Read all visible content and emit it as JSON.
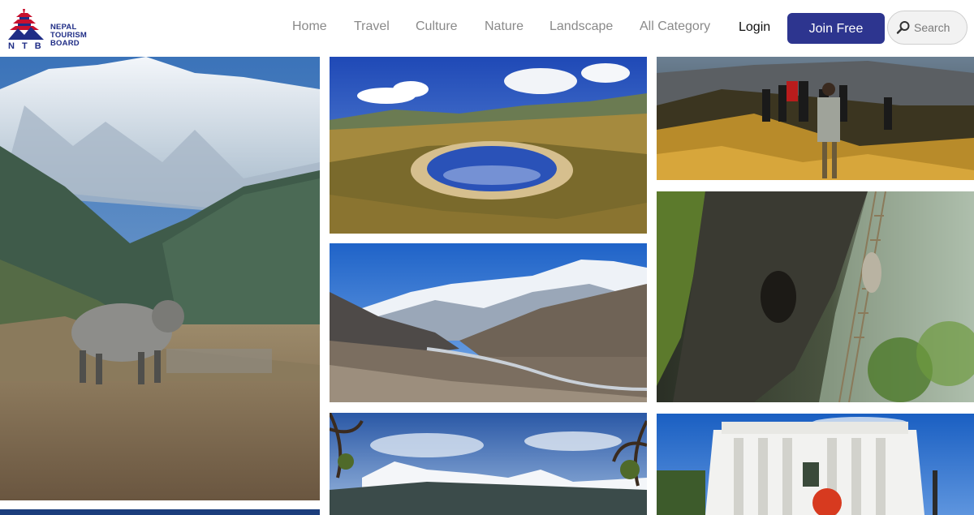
{
  "brand": {
    "line1": "NEPAL",
    "line2": "TOURISM",
    "line3": "BOARD",
    "abbr": "N T B",
    "color": "#1f2d86"
  },
  "nav": {
    "items": [
      {
        "label": "Home"
      },
      {
        "label": "Travel"
      },
      {
        "label": "Culture"
      },
      {
        "label": "Nature"
      },
      {
        "label": "Landscape"
      },
      {
        "label": "All Category"
      }
    ],
    "login": "Login",
    "join": "Join Free",
    "accent": "#2d358f"
  },
  "search": {
    "placeholder": "Search",
    "icon": "search-icon"
  },
  "gallery": {
    "photos": [
      {
        "subject": "mountain-yak"
      },
      {
        "subject": "alpine-lake"
      },
      {
        "subject": "trekkers-hill"
      },
      {
        "subject": "himalayan-valley"
      },
      {
        "subject": "honey-hunter-cliff"
      },
      {
        "subject": "mountain-view-branches"
      },
      {
        "subject": "white-palace-building"
      }
    ]
  }
}
